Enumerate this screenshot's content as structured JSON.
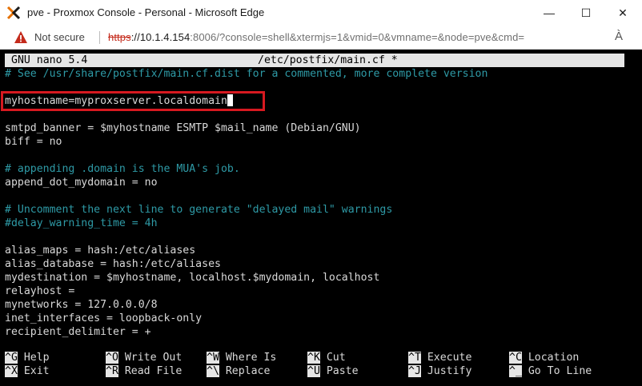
{
  "window": {
    "title": "pve - Proxmox Console - Personal - Microsoft Edge",
    "minimize_glyph": "—",
    "maximize_glyph": "☐",
    "close_glyph": "✕"
  },
  "addressbar": {
    "security_label": "Not secure",
    "url_scheme": "https",
    "url_host": "://10.1.4.154",
    "url_rest": ":8006/?console=shell&xtermjs=1&vmid=0&vmname=&node=pve&cmd=",
    "read_aloud_glyph": "À"
  },
  "terminal": {
    "header_app": "GNU nano 5.4",
    "header_file": "/etc/postfix/main.cf *",
    "lines": [
      {
        "text": "# See /usr/share/postfix/main.cf.dist for a commented, more complete version",
        "type": "comment"
      },
      {
        "text": "",
        "type": "text"
      },
      {
        "text": "myhostname=myproxserver.localdomain",
        "type": "edited"
      },
      {
        "text": "",
        "type": "text"
      },
      {
        "text": "smtpd_banner = $myhostname ESMTP $mail_name (Debian/GNU)",
        "type": "text"
      },
      {
        "text": "biff = no",
        "type": "text"
      },
      {
        "text": "",
        "type": "text"
      },
      {
        "text": "# appending .domain is the MUA's job.",
        "type": "comment"
      },
      {
        "text": "append_dot_mydomain = no",
        "type": "text"
      },
      {
        "text": "",
        "type": "text"
      },
      {
        "text": "# Uncomment the next line to generate \"delayed mail\" warnings",
        "type": "comment"
      },
      {
        "text": "#delay_warning_time = 4h",
        "type": "comment"
      },
      {
        "text": "",
        "type": "text"
      },
      {
        "text": "alias_maps = hash:/etc/aliases",
        "type": "text"
      },
      {
        "text": "alias_database = hash:/etc/aliases",
        "type": "text"
      },
      {
        "text": "mydestination = $myhostname, localhost.$mydomain, localhost",
        "type": "text"
      },
      {
        "text": "relayhost =",
        "type": "text"
      },
      {
        "text": "mynetworks = 127.0.0.0/8",
        "type": "text"
      },
      {
        "text": "inet_interfaces = loopback-only",
        "type": "text"
      },
      {
        "text": "recipient_delimiter = +",
        "type": "text"
      }
    ],
    "shortcuts_row1": [
      {
        "key": "^G",
        "label": "Help"
      },
      {
        "key": "^O",
        "label": "Write Out"
      },
      {
        "key": "^W",
        "label": "Where Is"
      },
      {
        "key": "^K",
        "label": "Cut"
      },
      {
        "key": "^T",
        "label": "Execute"
      },
      {
        "key": "^C",
        "label": "Location"
      }
    ],
    "shortcuts_row2": [
      {
        "key": "^X",
        "label": "Exit"
      },
      {
        "key": "^R",
        "label": "Read File"
      },
      {
        "key": "^\\",
        "label": "Replace"
      },
      {
        "key": "^U",
        "label": "Paste"
      },
      {
        "key": "^J",
        "label": "Justify"
      },
      {
        "key": "^_",
        "label": "Go To Line"
      }
    ],
    "colors": {
      "background": "#000000",
      "text": "#d9d9d9",
      "comment": "#2e9aa6",
      "highlight_box": "#d71920"
    }
  }
}
